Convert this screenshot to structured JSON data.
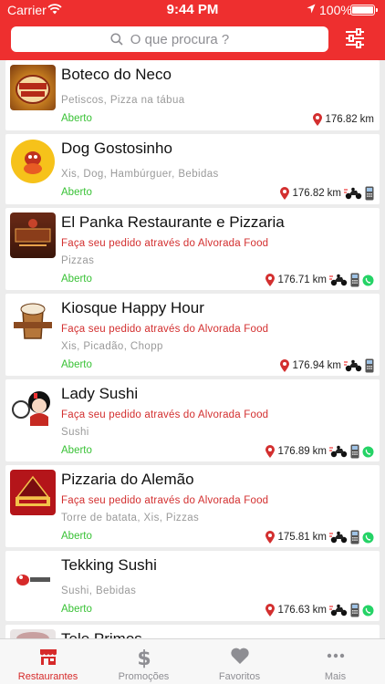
{
  "status_bar": {
    "carrier": "Carrier",
    "time": "9:44 PM",
    "battery": "100%"
  },
  "search": {
    "placeholder": "O que procura ?"
  },
  "restaurants": [
    {
      "name": "Boteco do Neco",
      "promo": "",
      "tags": "Petiscos, Pizza na tábua",
      "status": "Aberto",
      "distance": "176.82",
      "unit": "km",
      "delivery": false,
      "card": false,
      "whatsapp": false
    },
    {
      "name": "Dog Gostosinho",
      "promo": "",
      "tags": "Xis, Dog, Hambúrguer, Bebidas",
      "status": "Aberto",
      "distance": "176.82",
      "unit": "km",
      "delivery": true,
      "card": true,
      "whatsapp": false
    },
    {
      "name": "El Panka Restaurante e Pizzaria",
      "promo": "Faça seu pedido através do Alvorada Food",
      "tags": "Pizzas",
      "status": "Aberto",
      "distance": "176.71",
      "unit": "km",
      "delivery": true,
      "card": true,
      "whatsapp": true
    },
    {
      "name": "Kiosque Happy Hour",
      "promo": "Faça seu pedido através do Alvorada Food",
      "tags": "Xis, Picadão, Chopp",
      "status": "Aberto",
      "distance": "176.94",
      "unit": "km",
      "delivery": true,
      "card": true,
      "whatsapp": false
    },
    {
      "name": "Lady Sushi",
      "promo": "Faça seu pedido através do Alvorada Food",
      "tags": "Sushi",
      "status": "Aberto",
      "distance": "176.89",
      "unit": "km",
      "delivery": true,
      "card": true,
      "whatsapp": true
    },
    {
      "name": "Pizzaria do Alemão",
      "promo": "Faça seu pedido através do Alvorada Food",
      "tags": "Torre de batata, Xis, Pizzas",
      "status": "Aberto",
      "distance": "175.81",
      "unit": "km",
      "delivery": true,
      "card": true,
      "whatsapp": true
    },
    {
      "name": "Tekking Sushi",
      "promo": "",
      "tags": "Sushi, Bebidas",
      "status": "Aberto",
      "distance": "176.63",
      "unit": "km",
      "delivery": true,
      "card": true,
      "whatsapp": true
    },
    {
      "name": "Tele Primos",
      "promo": "",
      "tags": "",
      "status": "",
      "distance": "",
      "unit": "",
      "delivery": false,
      "card": false,
      "whatsapp": false
    }
  ],
  "tabs": [
    {
      "label": "Restaurantes",
      "icon": "store-icon",
      "active": true
    },
    {
      "label": "Promoções",
      "icon": "dollar-icon",
      "active": false
    },
    {
      "label": "Favoritos",
      "icon": "heart-icon",
      "active": false
    },
    {
      "label": "Mais",
      "icon": "more-icon",
      "active": false
    }
  ],
  "colors": {
    "brand": "#ee2f2f",
    "open": "#39c236",
    "promo": "#d32f2f",
    "whatsapp": "#25d366"
  }
}
